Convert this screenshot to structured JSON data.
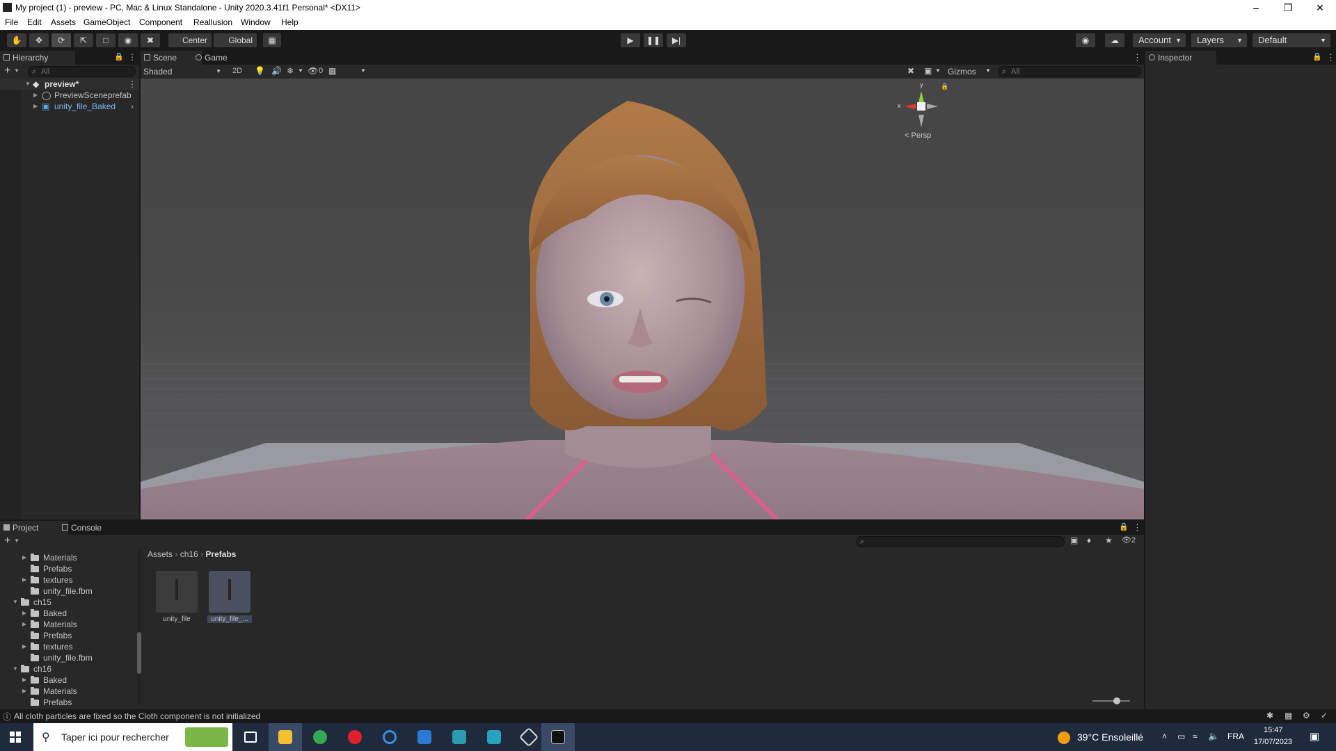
{
  "window": {
    "title": "My project (1) - preview - PC, Mac & Linux Standalone - Unity 2020.3.41f1 Personal* <DX11>"
  },
  "menu": [
    "File",
    "Edit",
    "Assets",
    "GameObject",
    "Component",
    "Reallusion",
    "Window",
    "Help"
  ],
  "toolbar": {
    "pivot": "Center",
    "space": "Global",
    "account": "Account",
    "layers": "Layers",
    "layout": "Default"
  },
  "hierarchy": {
    "tab": "Hierarchy",
    "search_placeholder": "All",
    "scene": "preview*",
    "items": [
      "PreviewSceneprefab",
      "unity_file_Baked"
    ]
  },
  "scene_view": {
    "tabs": [
      "Scene",
      "Game"
    ],
    "shading": "Shaded",
    "mode2d": "2D",
    "hidden_count": "0",
    "gizmos": "Gizmos",
    "search_placeholder": "All",
    "gizmo_axis_y": "y",
    "gizmo_axis_x": "x",
    "projection": "Persp"
  },
  "inspector": {
    "tab": "Inspector"
  },
  "project": {
    "tabs": [
      "Project",
      "Console"
    ],
    "hidden_count": "2",
    "tree": [
      {
        "label": "Materials",
        "indent": 1,
        "arrow": true
      },
      {
        "label": "Prefabs",
        "indent": 1,
        "arrow": false
      },
      {
        "label": "textures",
        "indent": 1,
        "arrow": true
      },
      {
        "label": "unity_file.fbm",
        "indent": 1,
        "arrow": false
      },
      {
        "label": "ch15",
        "indent": 0,
        "arrow": true
      },
      {
        "label": "Baked",
        "indent": 1,
        "arrow": true
      },
      {
        "label": "Materials",
        "indent": 1,
        "arrow": true
      },
      {
        "label": "Prefabs",
        "indent": 1,
        "arrow": false
      },
      {
        "label": "textures",
        "indent": 1,
        "arrow": true
      },
      {
        "label": "unity_file.fbm",
        "indent": 1,
        "arrow": false
      },
      {
        "label": "ch16",
        "indent": 0,
        "arrow": true
      },
      {
        "label": "Baked",
        "indent": 1,
        "arrow": true
      },
      {
        "label": "Materials",
        "indent": 1,
        "arrow": true
      },
      {
        "label": "Prefabs",
        "indent": 1,
        "arrow": false
      }
    ],
    "breadcrumb": [
      "Assets",
      "ch16",
      "Prefabs"
    ],
    "assets": [
      "unity_file",
      "unity_file_..."
    ]
  },
  "status": {
    "message": "All cloth particles are fixed so the Cloth component is not initialized"
  },
  "taskbar": {
    "search_placeholder": "Taper ici pour rechercher",
    "weather": "39°C  Ensoleillé",
    "lang": "FRA",
    "time": "15:47",
    "date": "17/07/2023"
  }
}
